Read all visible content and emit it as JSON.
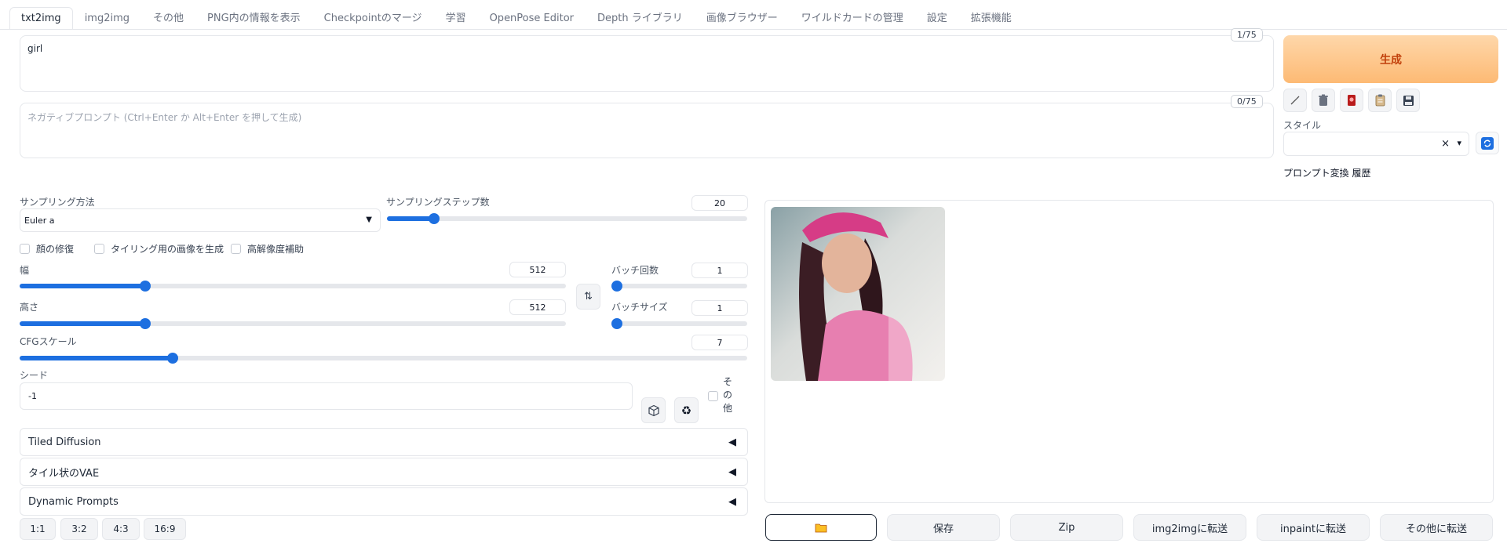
{
  "tabs": [
    {
      "label": "txt2img",
      "active": true
    },
    {
      "label": "img2img"
    },
    {
      "label": "その他"
    },
    {
      "label": "PNG内の情報を表示"
    },
    {
      "label": "Checkpointのマージ"
    },
    {
      "label": "学習"
    },
    {
      "label": "OpenPose Editor"
    },
    {
      "label": "Depth ライブラリ"
    },
    {
      "label": "画像ブラウザー"
    },
    {
      "label": "ワイルドカードの管理"
    },
    {
      "label": "設定"
    },
    {
      "label": "拡張機能"
    }
  ],
  "prompt": {
    "value": "girl",
    "counter": "1/75"
  },
  "negative_prompt": {
    "placeholder": "ネガティブプロンプト (Ctrl+Enter か Alt+Enter を押して生成)",
    "counter": "0/75"
  },
  "generate_label": "生成",
  "style": {
    "label": "スタイル",
    "clear": "×",
    "caret": "▾"
  },
  "prompt_history_label": "プロンプト変換 履歴",
  "sampler": {
    "label": "サンプリング方法",
    "value": "Euler a"
  },
  "steps": {
    "label": "サンプリングステップ数",
    "value": "20",
    "fraction": 0.13
  },
  "checkboxes": {
    "face": "顔の修復",
    "tiling": "タイリング用の画像を生成",
    "hires": "高解像度補助"
  },
  "width": {
    "label": "幅",
    "value": "512",
    "fraction": 0.23
  },
  "height": {
    "label": "高さ",
    "value": "512",
    "fraction": 0.23
  },
  "batch_count": {
    "label": "バッチ回数",
    "value": "1",
    "fraction": 0.0
  },
  "batch_size": {
    "label": "バッチサイズ",
    "value": "1",
    "fraction": 0.0
  },
  "swap_glyph": "⇅",
  "cfg": {
    "label": "CFGスケール",
    "value": "7",
    "fraction": 0.21
  },
  "seed": {
    "label": "シード",
    "value": "-1",
    "extra_label": "その他",
    "extra_chars": [
      "そ",
      "の",
      "他"
    ]
  },
  "accordions": [
    "Tiled Diffusion",
    "タイル状のVAE",
    "Dynamic Prompts"
  ],
  "accordion_icon": "◀",
  "ratios": [
    "1:1",
    "3:2",
    "4:3",
    "16:9"
  ],
  "actions": [
    "保存",
    "Zip",
    "img2imgに転送",
    "inpaintに転送",
    "その他に転送"
  ],
  "colors": {
    "accent": "#1d6fe0",
    "generate_text": "#c2410c"
  }
}
